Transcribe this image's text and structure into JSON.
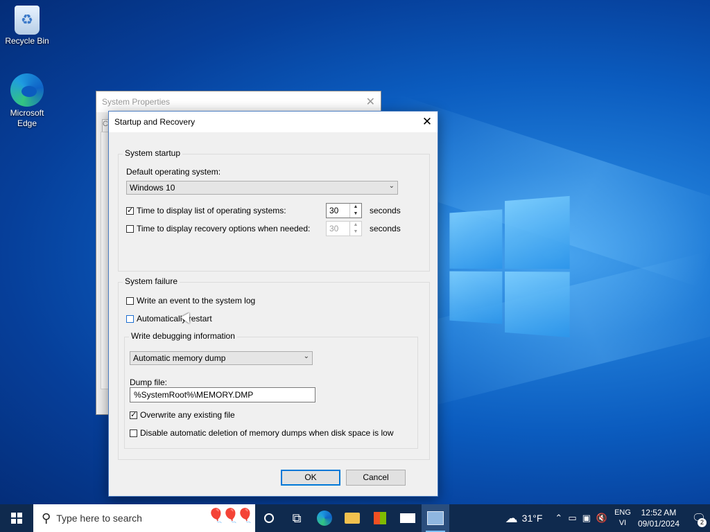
{
  "desktop": {
    "icons": [
      {
        "label": "Recycle Bin",
        "icon": "recycle-bin-icon"
      },
      {
        "label": "Microsoft Edge",
        "icon": "edge-icon"
      }
    ]
  },
  "background_window": {
    "title": "System Properties",
    "close_glyph": "✕",
    "tab_stub": "C"
  },
  "dialog": {
    "title": "Startup and Recovery",
    "close_glyph": "✕",
    "system_startup": {
      "group_label": "System startup",
      "default_os_label": "Default operating system:",
      "default_os_value": "Windows 10",
      "display_list": {
        "label": "Time to display list of operating systems:",
        "checked": true,
        "value": "30",
        "unit": "seconds"
      },
      "display_recovery": {
        "label": "Time to display recovery options when needed:",
        "checked": false,
        "value": "30",
        "unit": "seconds"
      }
    },
    "system_failure": {
      "group_label": "System failure",
      "write_event": {
        "label": "Write an event to the system log",
        "checked": false
      },
      "auto_restart": {
        "label": "Automatically restart",
        "checked": false
      },
      "debug_info": {
        "group_label": "Write debugging information",
        "dump_type": "Automatic memory dump",
        "dump_file_label": "Dump file:",
        "dump_file_value": "%SystemRoot%\\MEMORY.DMP",
        "overwrite": {
          "label": "Overwrite any existing file",
          "checked": true
        },
        "disable_auto_delete": {
          "label": "Disable automatic deletion of memory dumps when disk space is low",
          "checked": false
        }
      }
    },
    "ok_label": "OK",
    "cancel_label": "Cancel"
  },
  "taskbar": {
    "search_placeholder": "Type here to search",
    "weather_temp": "31°F",
    "lang_line1": "ENG",
    "lang_line2": "VI",
    "time": "12:52 AM",
    "date": "09/01/2024",
    "notification_count": "2"
  },
  "colors": {
    "accent": "#0078d7",
    "taskbar": "#0f2a4e"
  }
}
